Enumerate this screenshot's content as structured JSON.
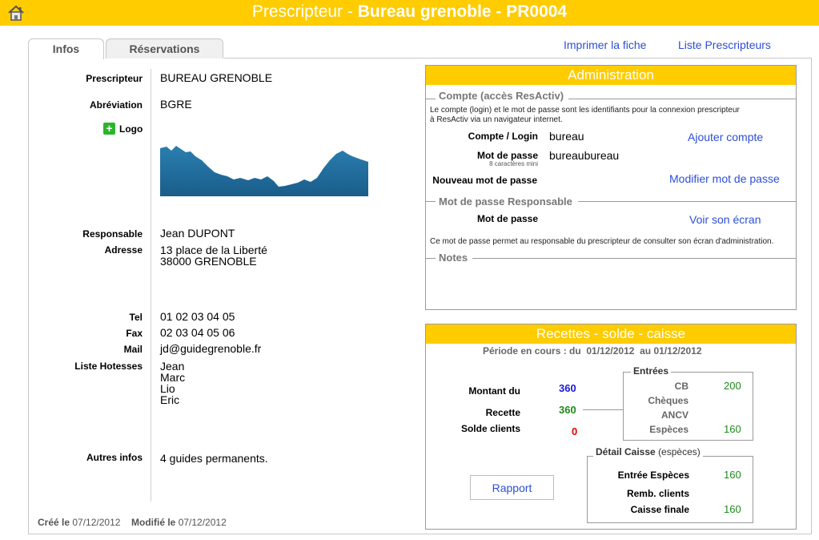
{
  "header": {
    "title_prefix": "Prescripteur - ",
    "title_main": "Bureau grenoble - PR0004",
    "home_icon": "home-icon"
  },
  "tabs": [
    {
      "label": "Infos",
      "active": true
    },
    {
      "label": "Réservations",
      "active": false
    }
  ],
  "links": {
    "print": "Imprimer la fiche",
    "list": "Liste Prescripteurs"
  },
  "info": {
    "prescripteur_label": "Prescripteur",
    "prescripteur_value": "BUREAU GRENOBLE",
    "abrev_label": "Abréviation",
    "abrev_value": "BGRE",
    "logo_label": "Logo",
    "responsable_label": "Responsable",
    "responsable_value": "Jean DUPONT",
    "adresse_label": "Adresse",
    "adresse_line1": "13 place de la Liberté",
    "adresse_line2": "38000 GRENOBLE",
    "tel_label": "Tel",
    "tel_value": "01 02 03 04 05",
    "fax_label": "Fax",
    "fax_value": "02 03 04 05 06",
    "mail_label": "Mail",
    "mail_value": "jd@guidegrenoble.fr",
    "hotesses_label": "Liste Hotesses",
    "hotesses": [
      "Jean",
      "Marc",
      "Lio",
      "Eric"
    ],
    "autres_label": "Autres infos",
    "autres_value": "4 guides permanents."
  },
  "footer": {
    "created_label": "Créé le",
    "created_date": "07/12/2012",
    "modified_label": "Modifié le",
    "modified_date": "07/12/2012"
  },
  "admin": {
    "title": "Administration",
    "compte_section": "Compte (accès ResActiv)",
    "compte_desc_1": "Le compte (login) et le mot de passe sont les identifiants pour la connexion prescripteur",
    "compte_desc_2": "à ResActiv via un navigateur internet.",
    "login_label": "Compte / Login",
    "login_value": "bureau",
    "add_account": "Ajouter compte",
    "pwd_label": "Mot de passe",
    "pwd_hint": "8 caractères mini",
    "pwd_value": "bureaubureau",
    "new_pwd_label": "Nouveau mot de passe",
    "modify_pwd": "Modifier mot de passe",
    "resp_section": "Mot de passe Responsable",
    "resp_pwd_label": "Mot de passe",
    "see_screen": "Voir son écran",
    "resp_desc": "Ce mot de passe permet au responsable du prescripteur de consulter son écran d'administration.",
    "notes_section": "Notes"
  },
  "recettes": {
    "title": "Recettes - solde - caisse",
    "periode_label": "Période en cours : du",
    "periode_from": "01/12/2012",
    "periode_to_label": "au",
    "periode_to": "01/12/2012",
    "montant_label": "Montant du",
    "montant_value": "360",
    "recette_label": "Recette",
    "recette_value": "360",
    "solde_label": "Solde clients",
    "solde_value": "0",
    "entrees_title": "Entrées",
    "cb_label": "CB",
    "cb_value": "200",
    "cheques_label": "Chèques",
    "ancv_label": "ANCV",
    "especes_label": "Espèces",
    "especes_value": "160",
    "detail_title": "Détail Caisse",
    "detail_sub": "(espèces)",
    "entree_esp_label": "Entrée Espèces",
    "entree_esp_value": "160",
    "remb_label": "Remb. clients",
    "caisse_label": "Caisse finale",
    "caisse_value": "160",
    "rapport": "Rapport"
  },
  "colors": {
    "accent": "#ffcc00",
    "link": "#2c4fd6",
    "blue_value": "#1a1ad6",
    "green_value": "#1c8a1c",
    "red_value": "#e00000"
  }
}
